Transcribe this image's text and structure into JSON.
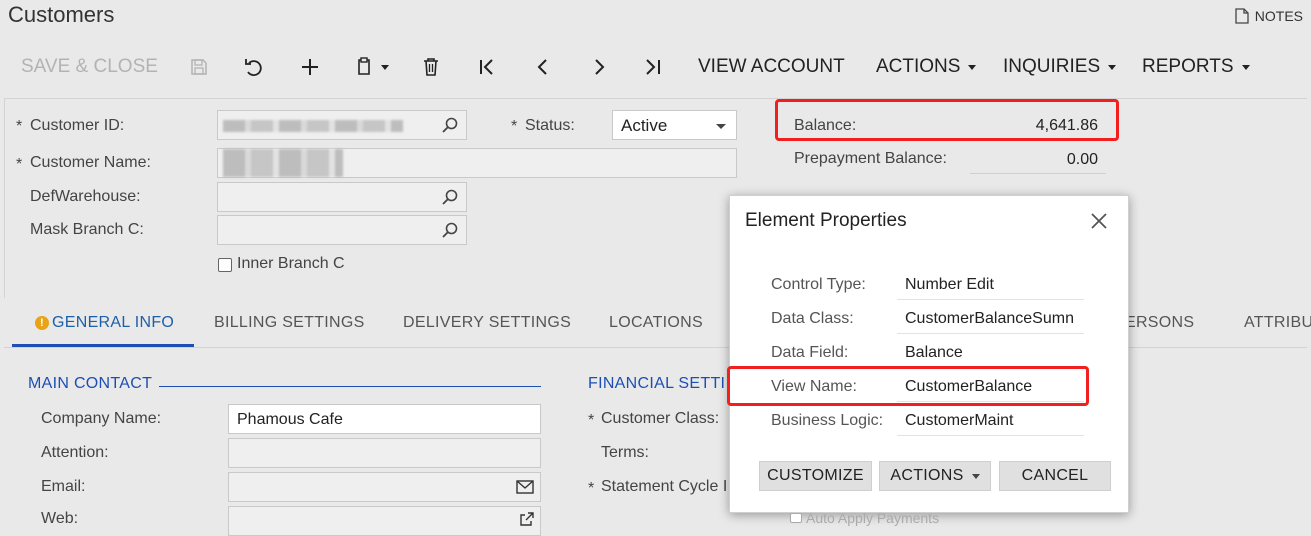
{
  "page": {
    "title": "Customers",
    "notes_label": "NOTES"
  },
  "toolbar": {
    "save_close": "SAVE & CLOSE",
    "view_account": "VIEW ACCOUNT",
    "actions": "ACTIONS",
    "inquiries": "INQUIRIES",
    "reports": "REPORTS"
  },
  "form": {
    "customer_id_label": "Customer ID:",
    "customer_name_label": "Customer Name:",
    "def_warehouse_label": "DefWarehouse:",
    "mask_branch_label": "Mask Branch C:",
    "inner_branch_label": "Inner Branch C",
    "status_label": "Status:",
    "status_value": "Active",
    "required_mark": "*"
  },
  "summary": {
    "balance_label": "Balance:",
    "balance_value": "4,641.86",
    "prepayment_label": "Prepayment Balance:",
    "prepayment_value": "0.00"
  },
  "tabs": [
    {
      "label": "GENERAL INFO",
      "active": true,
      "warning": "!"
    },
    {
      "label": "BILLING SETTINGS"
    },
    {
      "label": "DELIVERY SETTINGS"
    },
    {
      "label": "LOCATIONS"
    },
    {
      "label": "PERSONS"
    },
    {
      "label": "ATTRIBU"
    }
  ],
  "main_contact": {
    "section_title": "MAIN CONTACT",
    "company_label": "Company Name:",
    "company_value": "Phamous Cafe",
    "attention_label": "Attention:",
    "email_label": "Email:",
    "web_label": "Web:"
  },
  "financial": {
    "section_title": "FINANCIAL SETTI",
    "customer_class_label": "Customer Class:",
    "terms_label": "Terms:",
    "statement_cycle_label": "Statement Cycle I",
    "auto_apply_label": "Auto Apply Payments"
  },
  "dialog": {
    "title": "Element Properties",
    "rows": [
      {
        "label": "Control Type:",
        "value": "Number Edit"
      },
      {
        "label": "Data Class:",
        "value": "CustomerBalanceSumn"
      },
      {
        "label": "Data Field:",
        "value": "Balance"
      },
      {
        "label": "View Name:",
        "value": "CustomerBalance"
      },
      {
        "label": "Business Logic:",
        "value": "CustomerMaint"
      }
    ],
    "customize": "CUSTOMIZE",
    "actions": "ACTIONS",
    "cancel": "CANCEL"
  },
  "colors": {
    "accent": "#1d4fb3",
    "highlight": "#f21f1f",
    "warning": "#e8a317"
  }
}
